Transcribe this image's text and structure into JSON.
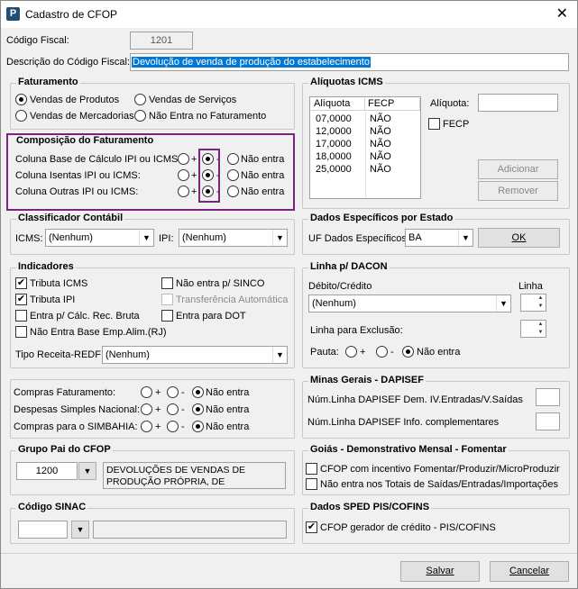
{
  "window": {
    "title": "Cadastro de CFOP",
    "app_icon": "P"
  },
  "codigo_fiscal": {
    "label": "Código Fiscal:",
    "value": "1201"
  },
  "descricao": {
    "label": "Descrição do Código Fiscal:",
    "value": "Devolução de venda de produção do estabelecimento"
  },
  "faturamento": {
    "title": "Faturamento",
    "vendas_produtos": "Vendas de Produtos",
    "vendas_servicos": "Vendas de Serviços",
    "vendas_mercadorias": "Vendas de Mercadorias",
    "nao_entra": "Não Entra no Faturamento"
  },
  "composicao": {
    "title": "Composição do Faturamento",
    "rows": [
      {
        "label": "Coluna Base de Cálculo IPI ou ICMS:"
      },
      {
        "label": "Coluna Isentas IPI ou ICMS:"
      },
      {
        "label": "Coluna Outras IPI ou ICMS:"
      }
    ],
    "plus": "+",
    "minus": "-",
    "nao_entra": "Não entra"
  },
  "aliquotas": {
    "title": "Alíquotas ICMS",
    "col_aliquota": "Alíquota",
    "col_fecp": "FECP",
    "rows": [
      {
        "aliquota": "07,0000",
        "fecp": "NÃO"
      },
      {
        "aliquota": "12,0000",
        "fecp": "NÃO"
      },
      {
        "aliquota": "17,0000",
        "fecp": "NÃO"
      },
      {
        "aliquota": "18,0000",
        "fecp": "NÃO"
      },
      {
        "aliquota": "25,0000",
        "fecp": "NÃO"
      }
    ],
    "aliquota_label": "Alíquota:",
    "fecp_label": "FECP",
    "adicionar": "Adicionar",
    "remover": "Remover"
  },
  "classificador": {
    "title": "Classificador Contábil",
    "icms_label": "ICMS:",
    "icms_value": "(Nenhum)",
    "ipi_label": "IPI:",
    "ipi_value": "(Nenhum)"
  },
  "dados_estado": {
    "title": "Dados Específicos por Estado",
    "uf_label": "UF Dados Específicos:",
    "uf_value": "BA",
    "ok": "OK"
  },
  "indicadores": {
    "title": "Indicadores",
    "tributa_icms": "Tributa ICMS",
    "tributa_ipi": "Tributa IPI",
    "entra_calc": "Entra p/ Cálc. Rec. Bruta",
    "nao_entra_base": "Não Entra Base Emp.Alim.(RJ)",
    "nao_entra_sinco": "Não entra p/ SINCO",
    "transferencia": "Transferência Automática",
    "entra_dot": "Entra para DOT",
    "tipo_receita_label": "Tipo Receita-REDF:",
    "tipo_receita_value": "(Nenhum)"
  },
  "dacon": {
    "title": "Linha p/ DACON",
    "debito_label": "Débito/Crédito",
    "debito_value": "(Nenhum)",
    "linha_label": "Linha",
    "exclusao_label": "Linha para Exclusão:",
    "pauta_label": "Pauta:",
    "plus": "+",
    "minus": "-",
    "nao_entra": "Não entra"
  },
  "compras": {
    "rows": [
      {
        "label": "Compras Faturamento:"
      },
      {
        "label": "Despesas Simples Nacional:"
      },
      {
        "label": "Compras para o SIMBAHIA:"
      }
    ],
    "plus": "+",
    "minus": "-",
    "nao_entra": "Não entra"
  },
  "minas": {
    "title": "Minas Gerais - DAPISEF",
    "linha1": "Núm.Linha DAPISEF Dem. IV.Entradas/V.Saídas",
    "linha2": "Núm.Linha DAPISEF Info. complementares"
  },
  "grupo_pai": {
    "title": "Grupo Pai do CFOP",
    "code": "1200",
    "desc_line1": "DEVOLUÇÕES DE VENDAS DE",
    "desc_line2": "PRODUÇÃO PRÓPRIA, DE"
  },
  "goias": {
    "title": "Goiás - Demonstrativo Mensal - Fomentar",
    "opt1": "CFOP com incentivo  Fomentar/Produzir/MicroProduzir",
    "opt2": "Não entra nos Totais de  Saídas/Entradas/Importações"
  },
  "sinac": {
    "title": "Código SINAC"
  },
  "sped": {
    "title": "Dados SPED PIS/COFINS",
    "gerador": "CFOP gerador de crédito - PIS/COFINS"
  },
  "buttons": {
    "salvar": "Salvar",
    "cancelar": "Cancelar"
  },
  "colors": {
    "highlight": "#0078d7",
    "annotation": "#7b2381"
  }
}
